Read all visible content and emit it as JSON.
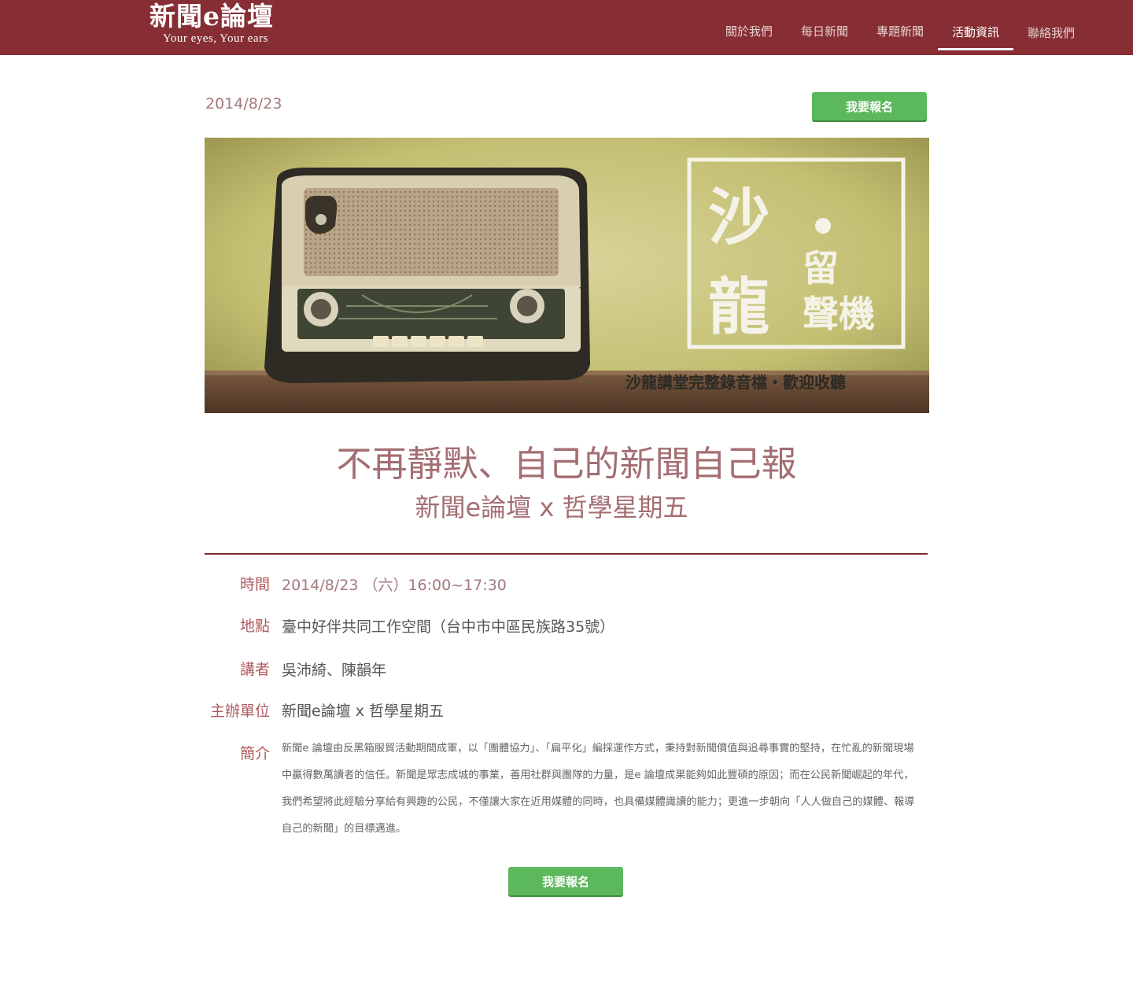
{
  "header": {
    "logo_title": "新聞e論壇",
    "logo_slogan": "Your eyes, Your ears",
    "nav": [
      {
        "label": "關於我們"
      },
      {
        "label": "每日新聞"
      },
      {
        "label": "專題新聞"
      },
      {
        "label": "活動資訊"
      },
      {
        "label": "聯絡我們"
      }
    ],
    "active_nav": "活動資訊"
  },
  "event": {
    "date": "2014/8/23",
    "register_label": "我要報名",
    "banner": {
      "title_big_1": "沙",
      "title_big_2": "龍",
      "title_small_1": "留",
      "title_small_2": "聲機",
      "caption": "沙龍講堂完整錄音檔・歡迎收聽"
    },
    "title": "不再靜默、自己的新聞自己報",
    "subtitle": "新聞e論壇 x 哲學星期五",
    "details": {
      "time_label": "時間",
      "time_value": "2014/8/23 （六）16:00~17:30",
      "place_label": "地點",
      "place_value": "臺中好伴共同工作空間（台中市中區民族路35號）",
      "speaker_label": "講者",
      "speaker_value": "吳沛綺、陳韻年",
      "organizer_label": "主辦單位",
      "organizer_value": "新聞e論壇 x 哲學星期五",
      "intro_label": "簡介",
      "intro_value": "新聞e 論壇由反黑箱服貿活動期間成軍，以「團體協力」、「扁平化」編採運作方式，秉持對新聞價值與追尋事實的堅持，在忙亂的新聞現場中贏得數萬讀者的信任。新聞是眾志成城的事業，善用社群與團隊的力量，是e 論壇成果能夠如此豐碩的原因；而在公民新聞崛起的年代，我們希望將此經驗分享給有興趣的公民，不僅讓大家在近用媒體的同時，也具備媒體識讀的能力；更進一步朝向「人人做自己的媒體、報導自己的新聞」的目標邁進。"
    }
  },
  "colors": {
    "header_bg": "#862e33",
    "accent_text": "#a46e72",
    "label_text": "#b05a5f",
    "button_green": "#5cb85c"
  }
}
